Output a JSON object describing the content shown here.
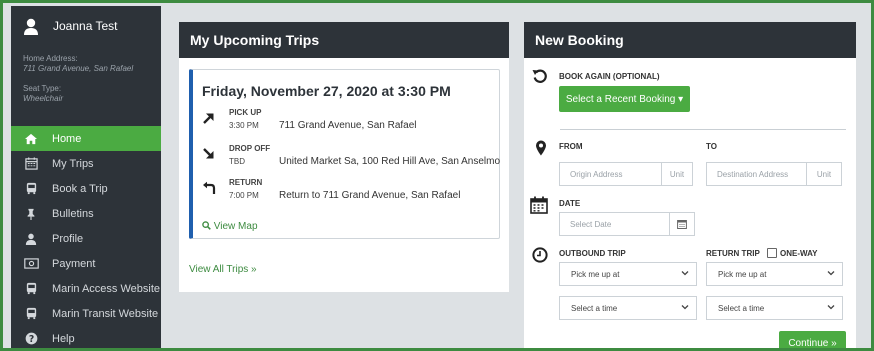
{
  "user": {
    "name": "Joanna Test",
    "home_label": "Home Address:",
    "home_value": "711 Grand Avenue, San Rafael",
    "seat_label": "Seat Type:",
    "seat_value": "Wheelchair"
  },
  "nav": [
    {
      "label": "Home",
      "icon": "home-icon",
      "active": true
    },
    {
      "label": "My Trips",
      "icon": "calendar-icon"
    },
    {
      "label": "Book a Trip",
      "icon": "bus-icon"
    },
    {
      "label": "Bulletins",
      "icon": "pin-icon"
    },
    {
      "label": "Profile",
      "icon": "user-icon"
    },
    {
      "label": "Payment",
      "icon": "money-icon"
    },
    {
      "label": "Marin Access Website",
      "icon": "bus-icon"
    },
    {
      "label": "Marin Transit Website",
      "icon": "bus-icon"
    },
    {
      "label": "Help",
      "icon": "help-icon"
    }
  ],
  "trips": {
    "title": "My Upcoming Trips",
    "date": "Friday, November 27, 2020 at 3:30 PM",
    "legs": [
      {
        "label": "PICK UP",
        "time": "3:30 PM",
        "address": "711 Grand Avenue, San Rafael",
        "icon": "arrow-up-right-icon"
      },
      {
        "label": "DROP OFF",
        "time": "TBD",
        "address": "United Market Sa, 100 Red Hill Ave, San Anselmo",
        "icon": "arrow-down-right-icon"
      },
      {
        "label": "RETURN",
        "time": "7:00 PM",
        "address": "Return to 711 Grand Avenue, San Rafael",
        "icon": "return-arrow-icon"
      }
    ],
    "view_map": "View Map",
    "view_all": "View All Trips »"
  },
  "booking": {
    "title": "New Booking",
    "book_again_label": "BOOK AGAIN (OPTIONAL)",
    "recent_button": "Select a Recent Booking ▾",
    "from_label": "FROM",
    "to_label": "TO",
    "origin_placeholder": "Origin Address",
    "unit_placeholder": "Unit",
    "destination_placeholder": "Destination Address",
    "date_label": "DATE",
    "date_placeholder": "Select Date",
    "outbound_label": "OUTBOUND TRIP",
    "return_label": "RETURN TRIP",
    "one_way_label": "ONE-WAY",
    "pickup_select": "Pick me up at",
    "time_select": "Select a time",
    "continue_button": "Continue »"
  },
  "colors": {
    "accent": "#4bab42",
    "sidebar": "#2d3339",
    "card_border": "#1f5fae"
  }
}
